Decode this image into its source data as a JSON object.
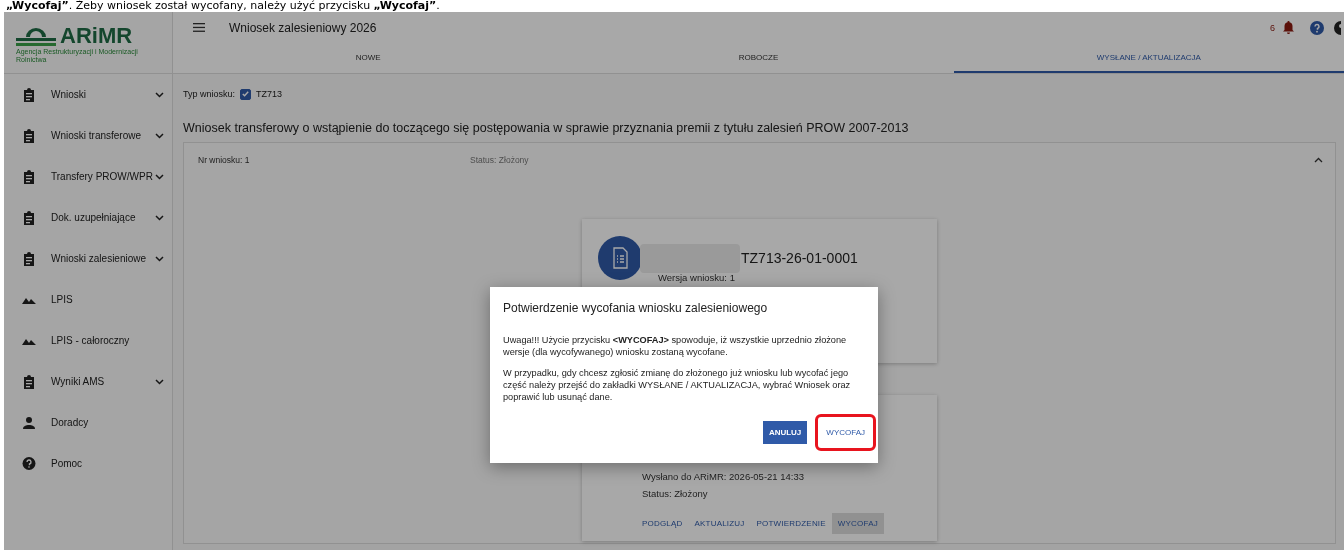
{
  "caption": {
    "text": "**„Wycofaj”**. Żeby wniosek został wycofany, należy użyć przycisku **„Wycofaj”**."
  },
  "logo": {
    "name": "ARiMR",
    "subtitle": "Agencja Restrukturyzacji i Modernizacji Rolnictwa"
  },
  "header": {
    "title": "Wniosek zalesieniowy 2026",
    "notification_count": "6"
  },
  "tabs": [
    {
      "label": "NOWE",
      "selected": false
    },
    {
      "label": "ROBOCZE",
      "selected": false
    },
    {
      "label": "WYSŁANE / AKTUALIZACJA",
      "selected": true
    }
  ],
  "sidebar": {
    "items": [
      {
        "label": "Wnioski",
        "kind": "documents",
        "expandable": true
      },
      {
        "label": "Wnioski transferowe",
        "kind": "documents",
        "expandable": true
      },
      {
        "label": "Transfery PROW/WPR",
        "kind": "documents",
        "expandable": true
      },
      {
        "label": "Dok. uzupełniające",
        "kind": "documents",
        "expandable": true
      },
      {
        "label": "Wnioski zalesieniowe",
        "kind": "documents",
        "expandable": true
      },
      {
        "label": "LPIS",
        "kind": "map",
        "expandable": false
      },
      {
        "label": "LPIS - całoroczny",
        "kind": "map",
        "expandable": false
      },
      {
        "label": "Wyniki AMS",
        "kind": "documents",
        "expandable": true
      },
      {
        "label": "Doradcy",
        "kind": "people",
        "expandable": false
      },
      {
        "label": "Pomoc",
        "kind": "help",
        "expandable": false
      }
    ]
  },
  "filter": {
    "label": "Typ wniosku:",
    "option": "TZ713",
    "checked": true
  },
  "heading": "Wniosek transferowy o wstąpienie do toczącego się postępowania w sprawie przyznania premii z tytułu zalesień PROW 2007-2013",
  "panel": {
    "number": "Nr wniosku: 1",
    "status": "Status: Złożony",
    "expanded": true
  },
  "card": {
    "number": "TZ713-26-01-0001",
    "version": "Wersja wniosku: 1"
  },
  "submission": {
    "sent": "Wysłano do ARiMR: 2026-05-21 14:33",
    "status": "Status: Złożony",
    "actions": [
      {
        "label": "PODGLĄD",
        "selected": false
      },
      {
        "label": "AKTUALIZUJ",
        "selected": false
      },
      {
        "label": "POTWIERDZENIE",
        "selected": false
      },
      {
        "label": "WYCOFAJ",
        "selected": true
      }
    ]
  },
  "dialog": {
    "title": "Potwierdzenie wycofania wniosku zalesieniowego",
    "paragraphs": [
      "Uwaga!!! Użycie przycisku **<WYCOFAJ>** spowoduje, iż wszystkie uprzednio złożone wersje (dla wycofywanego) wniosku zostaną wycofane.",
      "W przypadku, gdy chcesz zgłosić zmianę do złożonego już wniosku lub wycofać jego część należy przejść do zakładki WYSŁANE / AKTUALIZACJA, wybrać Wniosek oraz poprawić lub usunąć dane."
    ],
    "buttons": [
      {
        "label": "ANULUJ",
        "kind": "primary",
        "highlighted": false
      },
      {
        "label": "WYCOFAJ",
        "kind": "text",
        "highlighted": true
      }
    ]
  }
}
